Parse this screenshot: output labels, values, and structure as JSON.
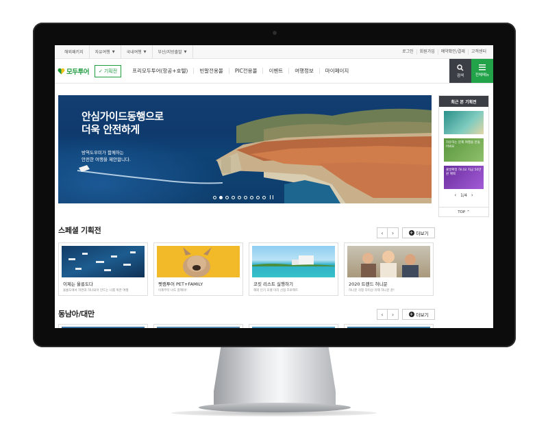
{
  "top_bar": {
    "left": [
      {
        "label": "해외패키지",
        "dropdown": false
      },
      {
        "label": "자유여행",
        "dropdown": true
      },
      {
        "label": "국내여행",
        "dropdown": true
      },
      {
        "label": "부산/지방출발",
        "dropdown": true
      }
    ],
    "right": [
      "로그인",
      "회원가입",
      "예약확인/결제",
      "고객센터"
    ]
  },
  "gnb": {
    "logo": "모두투어",
    "special_button": "기획전",
    "menu": [
      "프리모두투어(항공+호텔)",
      "빈말전용몰",
      "PIC전용몰",
      "이벤트",
      "여행정보",
      "마이페이지"
    ],
    "search_label": "검색",
    "all_menu_label": "전체메뉴",
    "icons": {
      "search": "search-icon",
      "menu": "hamburger-icon",
      "check": "check-icon"
    }
  },
  "hero": {
    "title_lines": [
      "안심가이드동행으로",
      "더욱 안전하게"
    ],
    "sub_lines": [
      "방역도우미가 함께하는",
      "안전한 여행을 제안합니다."
    ],
    "slide_count": 9,
    "active_slide": 2
  },
  "recent": {
    "title": "최근 본 기획전",
    "items": [
      {
        "text": "",
        "color": "#2a8f8a"
      },
      {
        "text": "자유하는 문제 여행을 만들어봐요",
        "color": "#58963c"
      },
      {
        "text": "출발확정 하나요 지금 50만원 혜택",
        "color": "#6a2f9e"
      }
    ],
    "page": "1/4",
    "top_label": "TOP"
  },
  "sections": [
    {
      "title": "스페셜 기획전",
      "more": "더보기",
      "cards": [
        {
          "title": "이제는 울릉도다",
          "sub": "울릉도에서 자연과 하나되어 만드는 나를 위한 여행"
        },
        {
          "title": "펫캠투어 PET+FAMILY",
          "sub": "이제부터 너도 함께야!"
        },
        {
          "title": "코킷 리스트 실행하기",
          "sub": "해외 인기 호텔 미리 선점 프로젝트"
        },
        {
          "title": "2020 트렌드 허니문",
          "sub": "허니문 걱정 더이상 이제 허니문 끝!"
        }
      ]
    },
    {
      "title": "동남아/대만",
      "more": "더보기"
    }
  ],
  "colors": {
    "brand_green": "#1e9a3e",
    "dark": "#3b3f45"
  }
}
